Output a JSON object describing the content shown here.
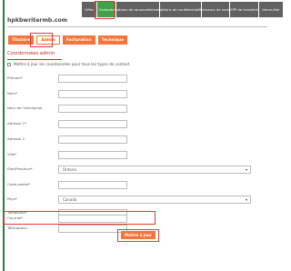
{
  "top_tabs": [
    {
      "label": "Offre"
    },
    {
      "label": "Contacts"
    },
    {
      "label": "Options de renouvellement"
    },
    {
      "label": "Options de confidentialité"
    },
    {
      "label": "Serveurs de noms"
    },
    {
      "label": "EPP de transfert"
    },
    {
      "label": "Verrouiller"
    }
  ],
  "domain_name": "hpkbwritermb.com",
  "sub_tabs": [
    {
      "label": "Titulaire"
    },
    {
      "label": "Admin"
    },
    {
      "label": "Facturation"
    },
    {
      "label": "Technique"
    }
  ],
  "section_title": "Coordonnées admin",
  "update_all_label": "Mettre à jour les coordonnées pour tous les types de contact",
  "fields": {
    "prenom": "Prénom*",
    "nom": "Nom*",
    "entreprise": "Nom de l'entreprise",
    "adresse1": "Adresse 1*",
    "adresse2": "Adresse 2",
    "ville": "Ville*",
    "etat": "État/Province*",
    "etat_value": "Ontario",
    "code_postal": "Code postal*",
    "pays": "Pays*",
    "pays_value": "Canada",
    "telephone": "Téléphone*",
    "telecopieur": "Télécopieur",
    "courriel": "Courriel*"
  },
  "submit_label": "Mettre à jour",
  "colors": {
    "accent": "#f4743b",
    "tab_active": "#43a047",
    "highlight": "#e53935"
  }
}
